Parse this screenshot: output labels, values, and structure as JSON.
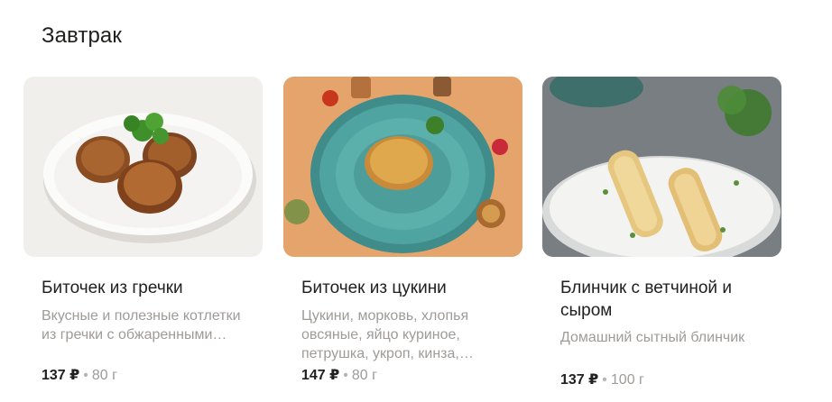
{
  "section": {
    "title": "Завтрак"
  },
  "items": [
    {
      "name": "Биточек из гречки",
      "description": "Вкусные и полезные котлетки из гречки с обжаренными…",
      "price": "137 ₽",
      "separator": "•",
      "weight": "80 г",
      "image_icon": "buckwheat-patties-photo"
    },
    {
      "name": "Биточек из цукини",
      "description": "Цукини, морковь, хлопья овсяные, яйцо куриное, петрушка, укроп, кинза,…",
      "price": "147 ₽",
      "separator": "•",
      "weight": "80 г",
      "image_icon": "zucchini-patty-photo"
    },
    {
      "name": "Блинчик с ветчиной и сыром",
      "description": "Домашний сытный блинчик",
      "price": "137 ₽",
      "separator": "•",
      "weight": "100 г",
      "image_icon": "ham-cheese-crepe-photo"
    }
  ],
  "colors": {
    "text_primary": "#21201f",
    "text_secondary": "#9e9b98",
    "background": "#ffffff"
  }
}
